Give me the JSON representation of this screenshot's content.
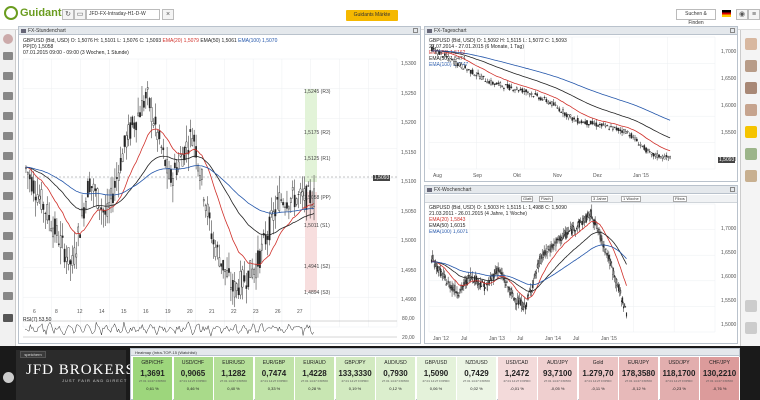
{
  "topbar": {
    "logo_text": "Guidants",
    "workspace": "JFD-FX-Intraday-H1-D-W",
    "gm_button": "Guidants Märkte",
    "search_button": "Suchen & Finden"
  },
  "hourly": {
    "title": "FX-Stundenchart",
    "line1": "GBPUSD (Bid, USD)  O: 1,5076  H: 1,5101  L: 1,5076  C: 1,5093",
    "ema20": "EMA(20)  1,5079",
    "ema50": "EMA(50)  1,5061",
    "ema100": "EMA(100)  1,5070",
    "pp": "PP(D)  1,5058",
    "range": "07.01.2015 09:00 - 09:00 (3 Wochen, 1 Stunde)",
    "pivots": [
      {
        "label": "1,5245 (R3)"
      },
      {
        "label": "1,5175 (R2)"
      },
      {
        "label": "1,5125 (R1)"
      },
      {
        "label": "1,5058 (PP)"
      },
      {
        "label": "1,5011 (S1)"
      },
      {
        "label": "1,4941 (S2)"
      },
      {
        "label": "1,4894 (S3)"
      }
    ],
    "yticks": [
      "1,5300",
      "1,5250",
      "1,5200",
      "1,5150",
      "1,5100",
      "1,5050",
      "1,5000",
      "1,4950",
      "1,4900"
    ],
    "last_price": "1,5093",
    "xticks": [
      "6",
      "8",
      "12",
      "14",
      "15",
      "16",
      "19",
      "20",
      "21",
      "22",
      "23",
      "26",
      "27"
    ],
    "rsi_label": "RSI(7)  53,50",
    "rsi_ticks": [
      "80,00",
      "20,00"
    ]
  },
  "daily": {
    "title": "FX-Tageschart",
    "line1": "GBPUSD (Bid, USD)  O: 1,5092  H: 1,5115  L: 1,5072  C: 1,5093",
    "range": "27.07.2014 - 27.01.2015 (6 Monate, 1 Tag)",
    "ema20": "EMA(20)  1,5162",
    "ema50": "EMA(50)  1,5474",
    "ema100": "EMA(100)  1,5647",
    "yticks": [
      "1,7000",
      "1,6500",
      "1,6000",
      "1,5500",
      "1,5000"
    ],
    "last_price": "1,5093",
    "xticks": [
      "Aug",
      "Sep",
      "Okt",
      "Nov",
      "Dez",
      "Jan '15"
    ]
  },
  "weekly": {
    "title": "FX-Wochenchart",
    "toolbar": [
      "Glatt",
      "Flach",
      "3 Jahre",
      "1 Woche",
      "Fibos"
    ],
    "line1": "GBPUSD (Bid, USD)  O: 1,5003  H: 1,5115  L: 1,4988  C: 1,5090",
    "range": "21.03.2011 - 26.01.2015 (4 Jahre, 1 Woche)",
    "ema20": "EMA(20)  1,5843",
    "ema50": "EMA(50)  1,6015",
    "ema100": "EMA(100)  1,6071",
    "yticks": [
      "1,7000",
      "1,6500",
      "1,6000",
      "1,5500",
      "1,5000"
    ],
    "xticks": [
      "Jan '12",
      "Jul",
      "Jan '13",
      "Jul",
      "Jan '14",
      "Jul",
      "Jan '15"
    ]
  },
  "heatmap": {
    "title": "Heatmap (Intra-TOP-15 (Watchlist)",
    "tiles": [
      {
        "sym": "GBP/CHF",
        "px": "1,3691",
        "tm": "27.01 14:27 FXPRO",
        "pct": "0,61 %",
        "color": "#9dd67c"
      },
      {
        "sym": "USD/CHF",
        "px": "0,9065",
        "tm": "27.01 14:27 FXPRO",
        "pct": "0,46 %",
        "color": "#a9da8a"
      },
      {
        "sym": "EUR/USD",
        "px": "1,1282",
        "tm": "27.01 14:27 FXPRO",
        "pct": "0,40 %",
        "color": "#b5df99"
      },
      {
        "sym": "EUR/GBP",
        "px": "0,7474",
        "tm": "27.01 14:27 FXPRO",
        "pct": "0,33 %",
        "color": "#c0e3a8"
      },
      {
        "sym": "EUR/AUD",
        "px": "1,4228",
        "tm": "27.01 14:27 FXPRO",
        "pct": "0,28 %",
        "color": "#c8e6b2"
      },
      {
        "sym": "GBP/JPY",
        "px": "133,3330",
        "tm": "27.01 14:27 FXPRO",
        "pct": "0,19 %",
        "color": "#d2eac0"
      },
      {
        "sym": "AUD/USD",
        "px": "0,7930",
        "tm": "27.01 14:27 FXPRO",
        "pct": "0,12 %",
        "color": "#dbeecd"
      },
      {
        "sym": "GBP/USD",
        "px": "1,5090",
        "tm": "27.01 14:27 FXPRO",
        "pct": "0,06 %",
        "color": "#e4f2da"
      },
      {
        "sym": "NZD/USD",
        "px": "0,7429",
        "tm": "27.01 14:27 FXPRO",
        "pct": "0,02 %",
        "color": "#ecf5e5"
      },
      {
        "sym": "USD/CAD",
        "px": "1,2472",
        "tm": "27.01 14:27 FXPRO",
        "pct": "-0,01 %",
        "color": "#f3dada"
      },
      {
        "sym": "AUD/JPY",
        "px": "93,7100",
        "tm": "27.01 14:27 FXPRO",
        "pct": "-0,05 %",
        "color": "#efcfcf"
      },
      {
        "sym": "Gold",
        "px": "1.279,70",
        "tm": "27.01 14:27 FXPRO",
        "pct": "-0,11 %",
        "color": "#ebc4c4"
      },
      {
        "sym": "EUR/JPY",
        "px": "178,3580",
        "tm": "27.01 14:27 FXPRO",
        "pct": "-0,12 %",
        "color": "#e7b9b9"
      },
      {
        "sym": "USD/JPY",
        "px": "118,1700",
        "tm": "27.01 14:27 FXPRO",
        "pct": "-0,23 %",
        "color": "#e2aeae"
      },
      {
        "sym": "CHF/JPY",
        "px": "130,2210",
        "tm": "27.01 14:27 FXPRO",
        "pct": "-0,76 %",
        "color": "#dc9b9b"
      }
    ]
  },
  "brand": {
    "name": "JFD BROKERS",
    "sub": "JUST FAIR AND DIRECT",
    "save": "speichern"
  }
}
